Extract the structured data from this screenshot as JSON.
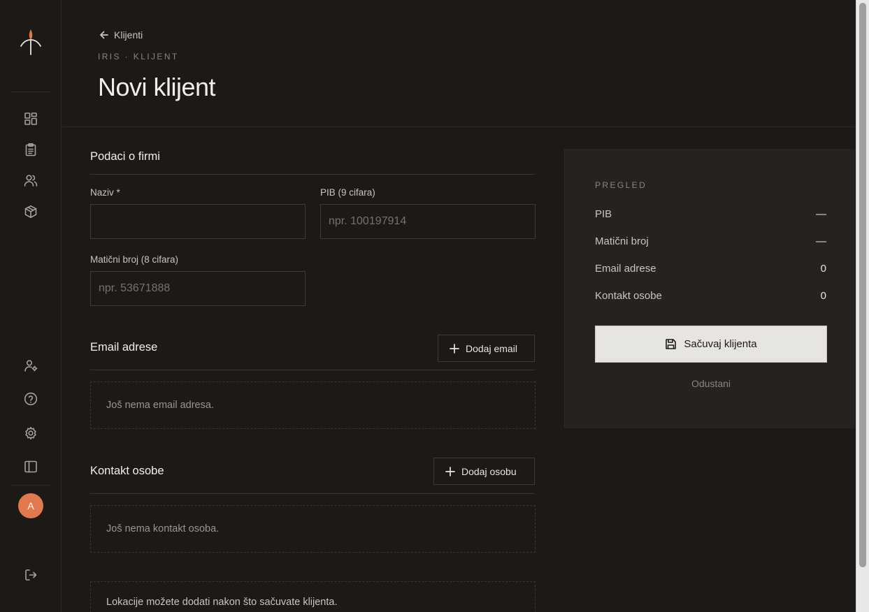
{
  "header": {
    "back_label": "Klijenti",
    "eyebrow": "IRIS · KLIJENT",
    "title": "Novi klijent"
  },
  "sidebar": {
    "top_icons": [
      "dashboard-icon",
      "clipboard-icon",
      "users-icon",
      "package-icon"
    ],
    "bottom_icons": [
      "user-settings-icon",
      "help-icon",
      "gear-icon",
      "sidebar-toggle-icon",
      "logout-icon"
    ],
    "avatar_initial": "A",
    "accent_color": "#e07a4e"
  },
  "company": {
    "section_title": "Podaci o firmi",
    "name_label": "Naziv *",
    "name_value": "",
    "pib_label": "PIB (9 cifara)",
    "pib_placeholder": "npr. 100197914",
    "mb_label": "Matični broj (8 cifara)",
    "mb_placeholder": "npr. 53671888"
  },
  "emails": {
    "section_title": "Email adrese",
    "add_label": "Dodaj email",
    "empty_text": "Još nema email adresa."
  },
  "contacts": {
    "section_title": "Kontakt osobe",
    "add_label": "Dodaj osobu",
    "empty_text": "Još nema kontakt osoba."
  },
  "locations": {
    "note": "Lokacije možete dodati nakon što sačuvate klijenta."
  },
  "summary": {
    "eyebrow": "PREGLED",
    "rows": [
      {
        "label": "PIB",
        "value": "—"
      },
      {
        "label": "Matični broj",
        "value": "—"
      },
      {
        "label": "Email adrese",
        "value": "0"
      },
      {
        "label": "Kontakt osobe",
        "value": "0"
      }
    ],
    "save_label": "Sačuvaj klijenta",
    "cancel_label": "Odustani"
  }
}
